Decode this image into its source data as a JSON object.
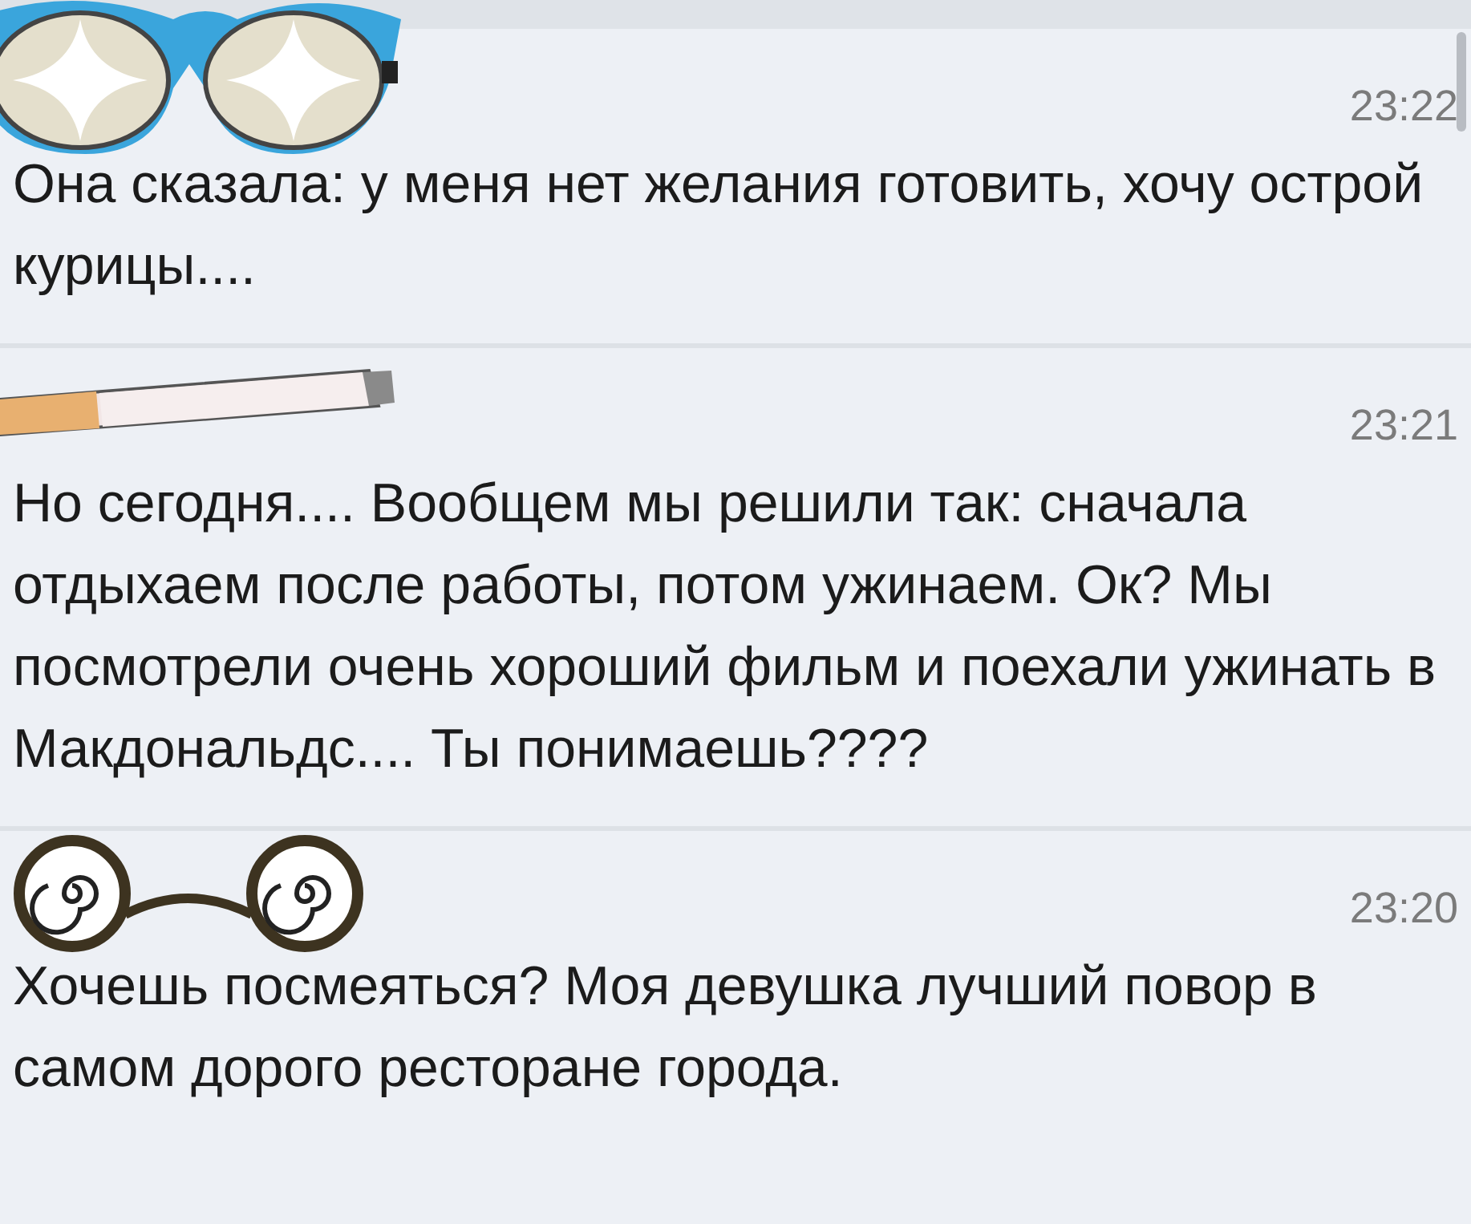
{
  "messages": [
    {
      "time": "23:22",
      "text": "Она сказала: у меня нет желания готовить, хочу острой курицы....",
      "sticker": {
        "kind": "star-glasses"
      }
    },
    {
      "time": "23:21",
      "text": "Но сегодня.... Вообщем мы решили так: сначала отдыхаем после работы, потом ужинаем. Ок? Мы посмотрели очень хороший фильм и поехали ужинать в Макдональдс.... Ты понимаешь????",
      "sticker": {
        "kind": "cigarette"
      }
    },
    {
      "time": "23:20",
      "text": "Хочешь посмеяться? Моя девушка лучший повор в самом дорого ресторане города.",
      "sticker": {
        "kind": "spiral-glasses"
      }
    }
  ]
}
